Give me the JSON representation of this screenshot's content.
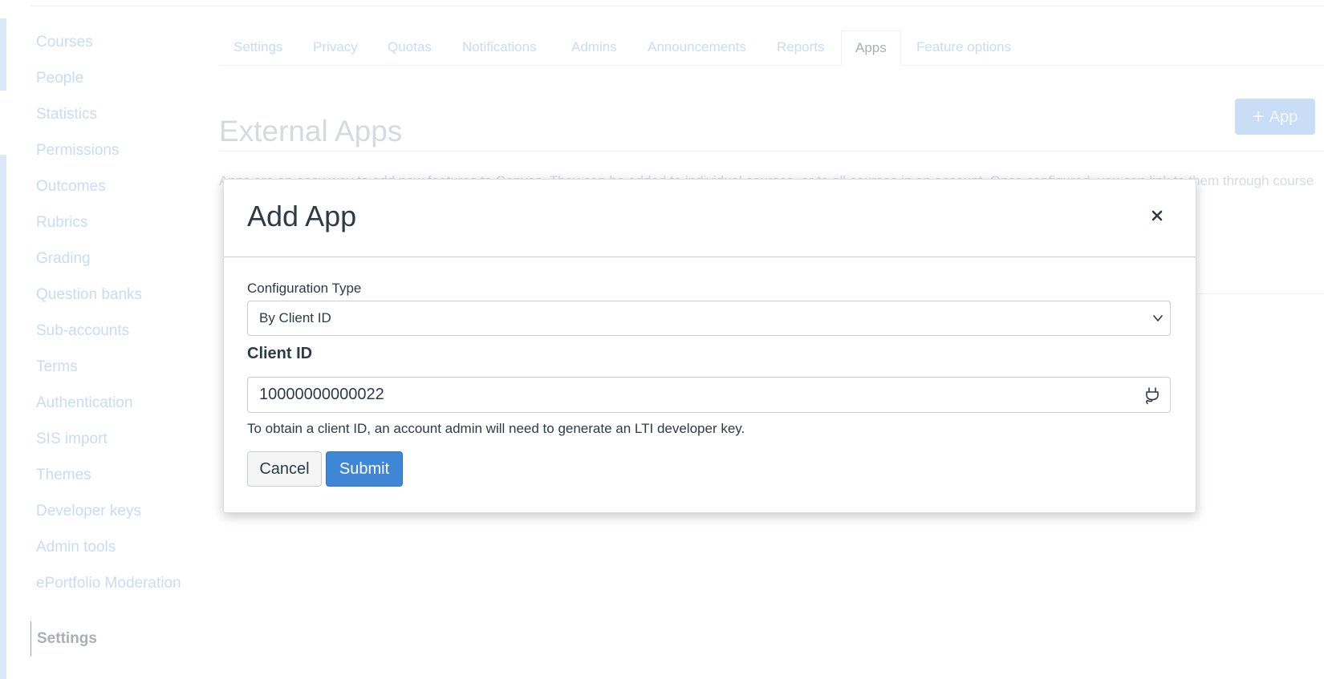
{
  "sidebar": {
    "items": [
      {
        "label": "Courses"
      },
      {
        "label": "People"
      },
      {
        "label": "Statistics"
      },
      {
        "label": "Permissions"
      },
      {
        "label": "Outcomes"
      },
      {
        "label": "Rubrics"
      },
      {
        "label": "Grading"
      },
      {
        "label": "Question banks"
      },
      {
        "label": "Sub-accounts"
      },
      {
        "label": "Terms"
      },
      {
        "label": "Authentication"
      },
      {
        "label": "SIS import"
      },
      {
        "label": "Themes"
      },
      {
        "label": "Developer keys"
      },
      {
        "label": "Admin tools"
      },
      {
        "label": "ePortfolio Moderation"
      },
      {
        "label": "Settings"
      }
    ],
    "active": "Settings"
  },
  "tabs": [
    {
      "label": "Settings"
    },
    {
      "label": "Privacy"
    },
    {
      "label": "Quotas"
    },
    {
      "label": "Notifications"
    },
    {
      "label": "Admins"
    },
    {
      "label": "Announcements"
    },
    {
      "label": "Reports"
    },
    {
      "label": "Apps"
    },
    {
      "label": "Feature options"
    }
  ],
  "active_tab": "Apps",
  "page": {
    "title": "External Apps",
    "add_button_label": "App",
    "description": "Apps are an easy way to add new features to Canvas. They can be added to individual courses, or to all courses in an account. Once configured, you can link to them through course"
  },
  "modal": {
    "title": "Add App",
    "config_type_label": "Configuration Type",
    "config_type_value": "By Client ID",
    "client_id_label": "Client ID",
    "client_id_value": "10000000000022",
    "hint": "To obtain a client ID, an account admin will need to generate an LTI developer key.",
    "cancel_label": "Cancel",
    "submit_label": "Submit"
  },
  "colors": {
    "primary": "#3f86d7",
    "text": "#2d3b45",
    "dimmed_link": "#c9dcf5"
  },
  "icons": [
    "close-icon",
    "chevron-down-icon",
    "plug-icon",
    "plus-icon"
  ]
}
